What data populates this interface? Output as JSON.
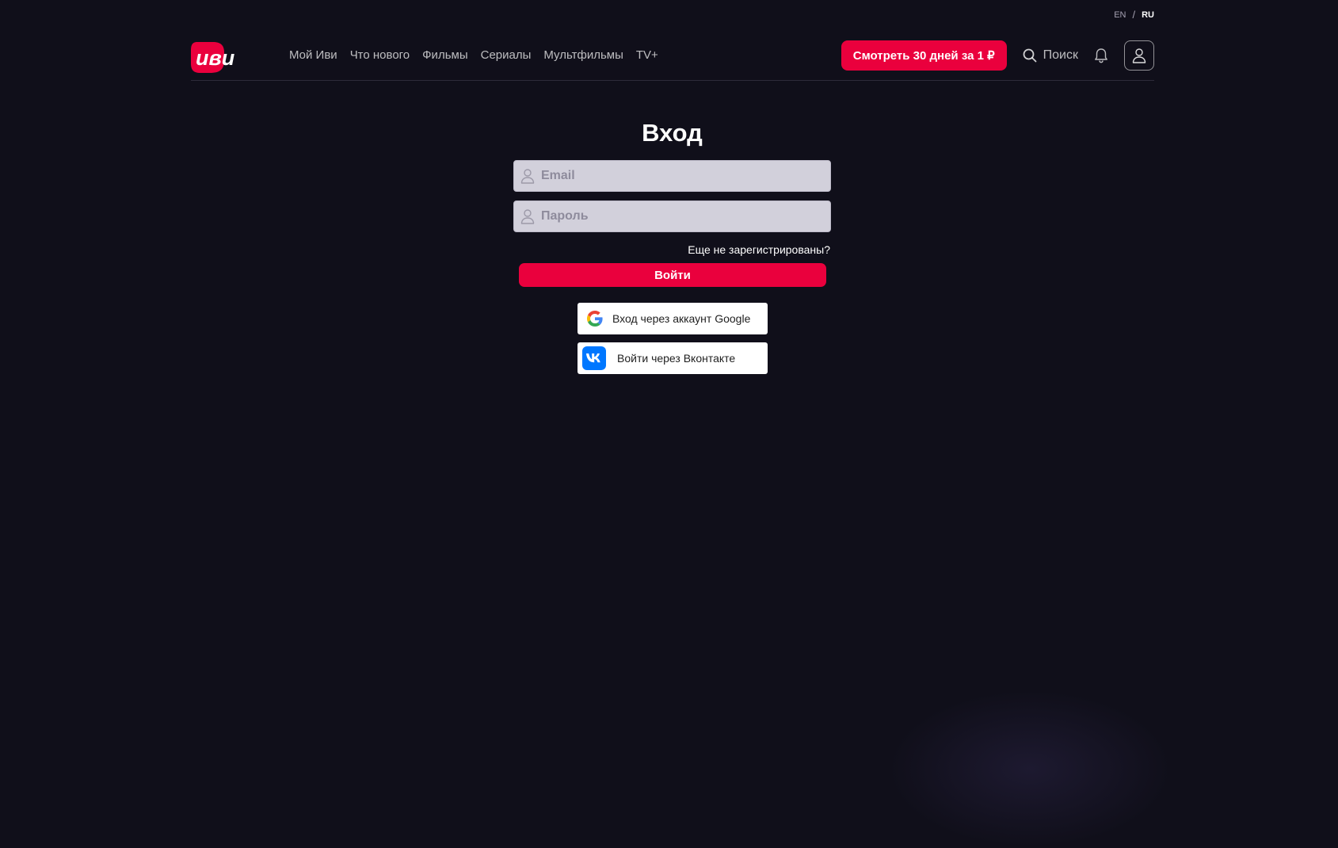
{
  "language": {
    "options": [
      "EN",
      "RU"
    ],
    "separator": "/",
    "active": "RU"
  },
  "header": {
    "logo_text": "иви",
    "nav": [
      {
        "label": "Мой Иви"
      },
      {
        "label": "Что нового"
      },
      {
        "label": "Фильмы"
      },
      {
        "label": "Сериалы"
      },
      {
        "label": "Мультфильмы"
      },
      {
        "label": "TV+"
      }
    ],
    "promo_button": "Смотреть 30 дней за 1 ₽",
    "search_label": "Поиск",
    "icons": {
      "search": "search-icon",
      "notifications": "bell-icon",
      "profile": "user-icon"
    }
  },
  "login": {
    "title": "Вход",
    "email": {
      "value": "",
      "placeholder": "Email",
      "icon": "user-icon"
    },
    "password": {
      "value": "",
      "placeholder": "Пароль",
      "icon": "user-icon"
    },
    "register_link": "Еще не зарегистрированы?",
    "submit_button": "Войти",
    "social": {
      "google": {
        "label": "Вход через аккаунт Google",
        "icon": "google-icon"
      },
      "vk": {
        "label": "Войти через Вконтакте",
        "icon": "vk-icon"
      }
    }
  },
  "colors": {
    "background": "#100f1a",
    "accent": "#ea003d",
    "field_background": "#d2d0db",
    "vk_blue": "#0077ff"
  }
}
